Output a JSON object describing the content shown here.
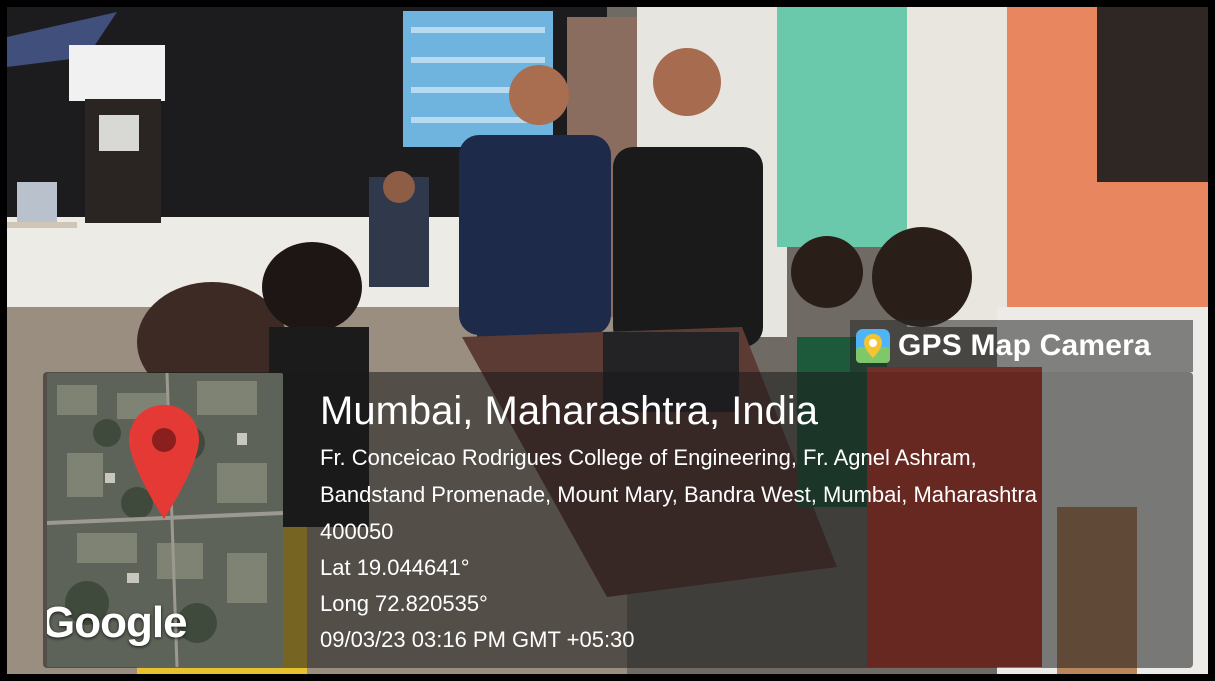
{
  "overlay": {
    "app_name": "GPS Map Camera",
    "app_icon": "map-pin-app-icon",
    "location_title": "Mumbai, Maharashtra, India",
    "address_line_1": "Fr. Conceicao Rodrigues College of Engineering, Fr. Agnel Ashram,",
    "address_line_2": "Bandstand Promenade, Mount Mary, Bandra West, Mumbai, Maharashtra",
    "address_line_3": "400050",
    "latitude": "Lat 19.044641°",
    "longitude": "Long 72.820535°",
    "timestamp": "09/03/23 03:16 PM GMT +05:30",
    "map_attribution": "Google",
    "map_marker_icon": "red-location-pin-icon"
  },
  "colors": {
    "marker_red": "#e53935",
    "overlay_bg": "#262626",
    "text": "#ffffff"
  }
}
